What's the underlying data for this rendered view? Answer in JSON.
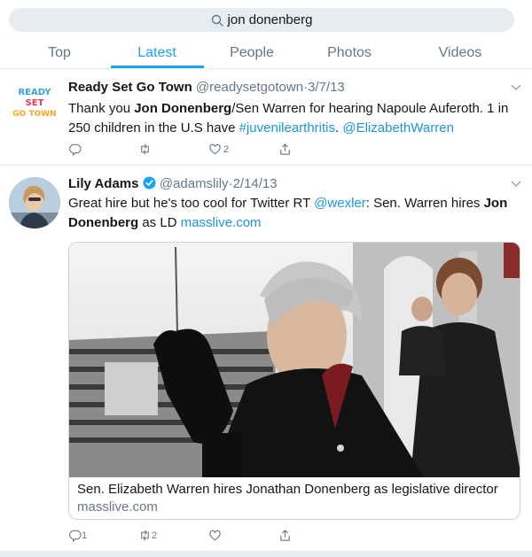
{
  "search": {
    "query": "jon donenberg"
  },
  "tabs": [
    {
      "label": "Top"
    },
    {
      "label": "Latest"
    },
    {
      "label": "People"
    },
    {
      "label": "Photos"
    },
    {
      "label": "Videos"
    }
  ],
  "tweets": [
    {
      "avatar_text": {
        "l1": "READY",
        "l2": "SET",
        "l3": "GO TOWN"
      },
      "name": "Ready Set Go Town",
      "handle": "@readysetgotown",
      "sep": "·",
      "date": "3/7/13",
      "text": {
        "p1": "Thank you ",
        "b1": "Jon Donenberg",
        "p2": "/Sen Warren for hearing Napoule Auferoth. 1 in",
        "p3": "250 children in the U.S have ",
        "hashtag": "#juvenilearthritis",
        "p4": ". ",
        "mention": "@ElizabethWarren"
      },
      "likes": "2"
    },
    {
      "name": "Lily Adams",
      "handle": "@adamslily",
      "sep": "·",
      "date": "2/14/13",
      "text": {
        "p1": "Great hire but he's too cool for Twitter RT ",
        "mention": "@wexler",
        "p2": ": Sen. Warren hires ",
        "b1": "Jon",
        "b2": "Donenberg",
        "p3": " as LD ",
        "link": "masslive.com"
      },
      "card": {
        "title": "Sen. Elizabeth Warren hires Jonathan Donenberg as legislative director",
        "domain": "masslive.com"
      },
      "replies": "1",
      "retweets": "2"
    }
  ],
  "colors": {
    "accent": "#1da1f2",
    "muted": "#657786",
    "link": "#1b95e0",
    "border": "#e6ecf0"
  }
}
